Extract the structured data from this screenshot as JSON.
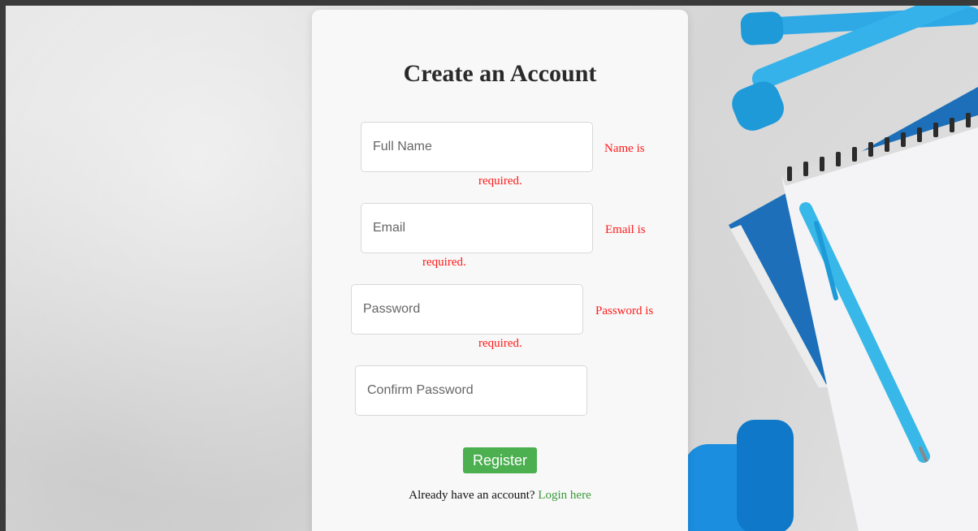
{
  "form": {
    "title": "Create an Account",
    "fields": {
      "full_name": {
        "value": "",
        "placeholder": "Full Name",
        "error_part1": "Name is",
        "error_part2": "required."
      },
      "email": {
        "value": "",
        "placeholder": "Email",
        "error_part1": "Email is",
        "error_part2": "required."
      },
      "password": {
        "value": "",
        "placeholder": "Password",
        "error_part1": "Password is",
        "error_part2": "required."
      },
      "confirm_password": {
        "value": "",
        "placeholder": "Confirm Password"
      }
    },
    "register_label": "Register",
    "login_prompt": "Already have an account?",
    "login_link": "Login here"
  },
  "colors": {
    "error": "#ff1a1a",
    "button": "#4caf50",
    "link": "#3a9a3a",
    "card": "#f8f8f8"
  }
}
